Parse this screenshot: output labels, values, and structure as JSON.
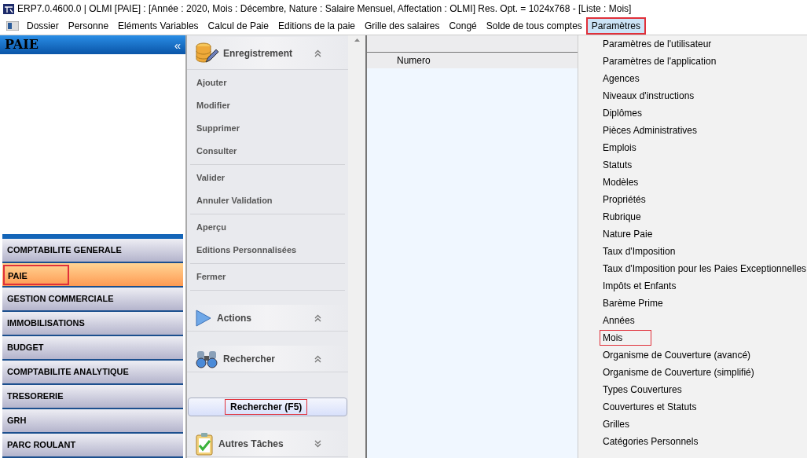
{
  "window": {
    "title": "ERP7.0.4600.0 | OLMI [PAIE] : [Année : 2020, Mois : Décembre, Nature : Salaire Mensuel, Affectation : OLMI] Res. Opt. = 1024x768 - [Liste : Mois]"
  },
  "menu_bar": [
    {
      "label": "Dossier",
      "selected": false
    },
    {
      "label": "Personne",
      "selected": false
    },
    {
      "label": "Eléments Variables",
      "selected": false
    },
    {
      "label": "Calcul de Paie",
      "selected": false
    },
    {
      "label": "Editions de la paie",
      "selected": false
    },
    {
      "label": "Grille des salaires",
      "selected": false
    },
    {
      "label": "Congé",
      "selected": false
    },
    {
      "label": "Solde de tous comptes",
      "selected": false
    },
    {
      "label": "Paramètres",
      "selected": true
    }
  ],
  "sidebar": {
    "title": "PAIE",
    "collapse_glyph": "«",
    "modules": [
      {
        "label": "COMPTABILITE GENERALE",
        "selected": false
      },
      {
        "label": "PAIE",
        "selected": true
      },
      {
        "label": "GESTION COMMERCIALE",
        "selected": false
      },
      {
        "label": "IMMOBILISATIONS",
        "selected": false
      },
      {
        "label": "BUDGET",
        "selected": false
      },
      {
        "label": "COMPTABILITE ANALYTIQUE",
        "selected": false
      },
      {
        "label": "TRESORERIE",
        "selected": false
      },
      {
        "label": "GRH",
        "selected": false
      },
      {
        "label": "PARC ROULANT",
        "selected": false
      }
    ]
  },
  "task_pane": [
    {
      "kind": "database",
      "title": "Enregistrement",
      "expanded": true,
      "groups": [
        [
          "Ajouter",
          "Modifier",
          "Supprimer",
          "Consulter"
        ],
        [
          "Valider",
          "Annuler Validation"
        ],
        [
          "Aperçu",
          "Editions Personnalisées"
        ],
        [
          "Fermer"
        ]
      ]
    },
    {
      "kind": "play",
      "title": "Actions",
      "expanded": true
    },
    {
      "kind": "binoculars",
      "title": "Rechercher",
      "expanded": true,
      "button": "Rechercher (F5)"
    },
    {
      "kind": "clipboard",
      "title": "Autres Tâches",
      "expanded": false
    }
  ],
  "grid": {
    "columns": [
      "Numero"
    ]
  },
  "dropdown": [
    {
      "label": "Paramètres de l'utilisateur",
      "selected": false
    },
    {
      "label": "Paramètres de l'application",
      "selected": false
    },
    {
      "label": "Agences",
      "selected": false
    },
    {
      "label": "Niveaux d'instructions",
      "selected": false
    },
    {
      "label": "Diplômes",
      "selected": false
    },
    {
      "label": "Pièces Administratives",
      "selected": false
    },
    {
      "label": "Emplois",
      "selected": false
    },
    {
      "label": "Statuts",
      "selected": false
    },
    {
      "label": "Modèles",
      "selected": false
    },
    {
      "label": "Propriétés",
      "selected": false
    },
    {
      "label": "Rubrique",
      "selected": false
    },
    {
      "label": "Nature Paie",
      "selected": false
    },
    {
      "label": "Taux d'Imposition",
      "selected": false
    },
    {
      "label": "Taux d'Imposition pour les Paies Exceptionnelles",
      "selected": false
    },
    {
      "label": "Impôts et  Enfants",
      "selected": false
    },
    {
      "label": "Barème Prime",
      "selected": false
    },
    {
      "label": "Années",
      "selected": false
    },
    {
      "label": "Mois",
      "selected": true
    },
    {
      "label": "Organisme de Couverture (avancé)",
      "selected": false
    },
    {
      "label": "Organisme de Couverture (simplifié)",
      "selected": false
    },
    {
      "label": "Types Couvertures",
      "selected": false
    },
    {
      "label": "Couvertures et  Statuts",
      "selected": false
    },
    {
      "label": "Grilles",
      "selected": false
    },
    {
      "label": "Catégories Personnels",
      "selected": false
    }
  ]
}
